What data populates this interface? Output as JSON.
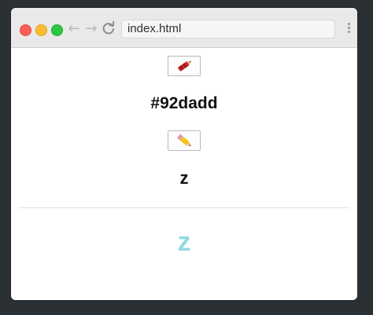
{
  "browser": {
    "address_text": "index.html",
    "back_icon": "arrow-left-icon",
    "forward_icon": "arrow-right-icon",
    "reload_icon": "reload-icon",
    "menu_icon": "kebab-menu-icon"
  },
  "page": {
    "button1_icon": "red-crayon-icon",
    "color_text": "#92dadd",
    "button2_icon": "pencil-icon",
    "letter_text": "z",
    "display_letter": "z",
    "display_letter_color": "#92dadd"
  }
}
